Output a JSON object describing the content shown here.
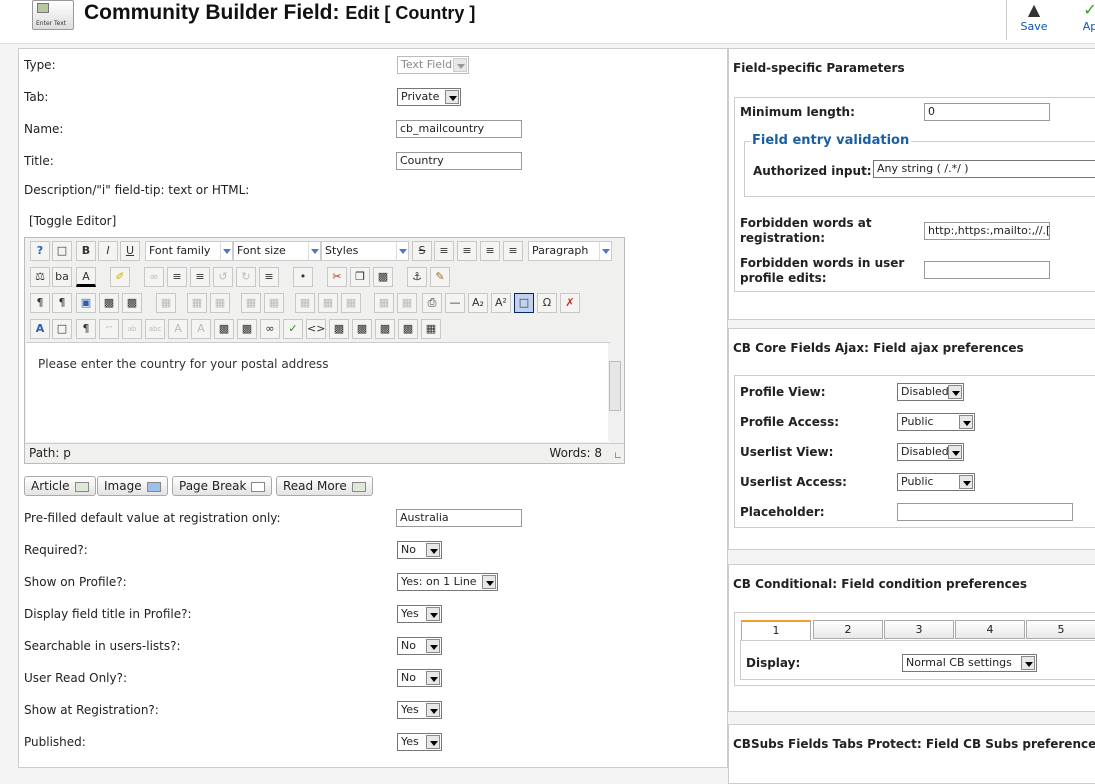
{
  "header": {
    "title_main": "Community Builder Field:",
    "title_sub": "Edit [ Country ]",
    "icon_caption": "Enter Text",
    "toolbar": {
      "save_label": "Save",
      "apply_label": "Ap"
    }
  },
  "left": {
    "type": {
      "label": "Type:",
      "value": "Text Field"
    },
    "tab": {
      "label": "Tab:",
      "value": "Private"
    },
    "name": {
      "label": "Name:",
      "value": "cb_mailcountry"
    },
    "title": {
      "label": "Title:",
      "value": "Country"
    },
    "description": {
      "label": "Description/\"i\" field-tip: text or HTML:"
    },
    "toggle_editor": "[Toggle Editor]",
    "editor": {
      "font_family": "Font family",
      "font_size": "Font size",
      "styles": "Styles",
      "format": "Paragraph",
      "content": "Please enter the country for your postal address",
      "path_label": "Path:",
      "path_value": "p",
      "words": "Words: 8"
    },
    "buttons": {
      "article": "Article",
      "image": "Image",
      "page_break": "Page Break",
      "read_more": "Read More"
    },
    "prefilled": {
      "label": "Pre-filled default value at registration only:",
      "value": "Australia"
    },
    "required": {
      "label": "Required?:",
      "value": "No"
    },
    "show_profile": {
      "label": "Show on Profile?:",
      "value": "Yes: on 1 Line"
    },
    "display_title": {
      "label": "Display field title in Profile?:",
      "value": "Yes"
    },
    "searchable": {
      "label": "Searchable in users-lists?:",
      "value": "No"
    },
    "read_only": {
      "label": "User Read Only?:",
      "value": "No"
    },
    "show_registration": {
      "label": "Show at Registration?:",
      "value": "Yes"
    },
    "published": {
      "label": "Published:",
      "value": "Yes"
    }
  },
  "right": {
    "field_specific": {
      "title": "Field-specific Parameters",
      "min_length": {
        "label": "Minimum length:",
        "value": "0"
      },
      "validation_legend": "Field entry validation",
      "authorized": {
        "label": "Authorized input:",
        "value": "Any string ( /.*/ )"
      },
      "forbidden_reg": {
        "label": "Forbidden words at registration:",
        "value": "http:,https:,mailto:,//.[url],<"
      },
      "forbidden_edit": {
        "label": "Forbidden words in user profile edits:",
        "value": ""
      }
    },
    "ajax": {
      "title": "CB Core Fields Ajax: Field ajax preferences",
      "profile_view": {
        "label": "Profile View:",
        "value": "Disabled"
      },
      "profile_access": {
        "label": "Profile Access:",
        "value": "Public"
      },
      "userlist_view": {
        "label": "Userlist View:",
        "value": "Disabled"
      },
      "userlist_access": {
        "label": "Userlist Access:",
        "value": "Public"
      },
      "placeholder": {
        "label": "Placeholder:",
        "value": ""
      }
    },
    "conditional": {
      "title": "CB Conditional: Field condition preferences",
      "tabs": [
        "1",
        "2",
        "3",
        "4",
        "5"
      ],
      "display": {
        "label": "Display:",
        "value": "Normal CB settings"
      }
    },
    "cbsubs": {
      "title": "CBSubs Fields Tabs Protect: Field CB Subs preferences"
    }
  }
}
